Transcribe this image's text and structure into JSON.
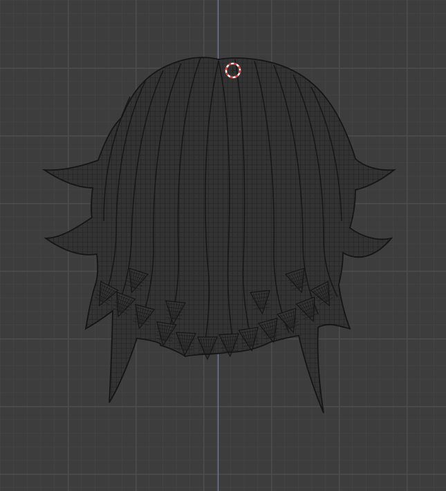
{
  "viewport": {
    "view": "3d-viewport-wireframe-front",
    "object": "hair-mesh",
    "colors": {
      "background": "#3d3d3d",
      "grid_minor": "#484848",
      "grid_major": "#4f4f4f",
      "z_axis": "#5a80c8",
      "mesh_fill": "#333333",
      "mesh_wire": "#1b1b1b",
      "mesh_outline": "#151515",
      "cursor_red": "#e03a3a",
      "cursor_white": "#f2f2f2"
    },
    "icons": {
      "cursor": "3d-cursor-icon"
    }
  }
}
